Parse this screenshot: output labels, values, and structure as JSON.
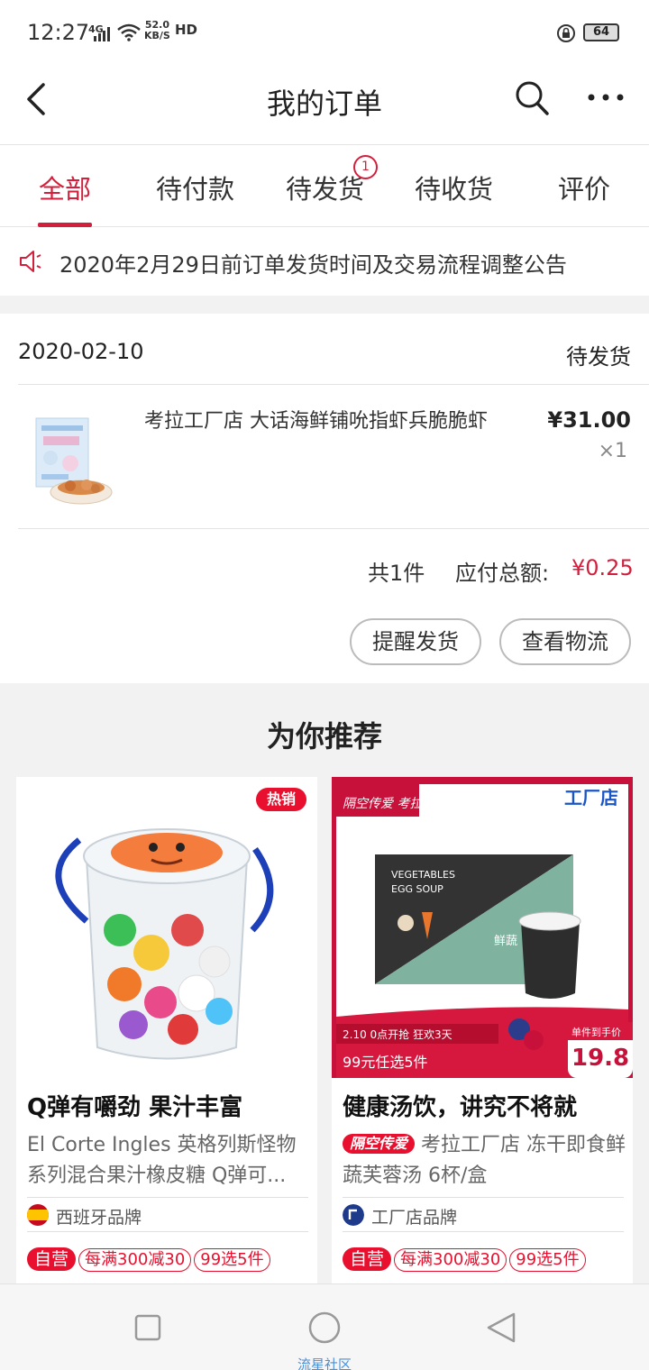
{
  "status_bar": {
    "time": "12:27",
    "network": "4G",
    "speed_value": "52.0",
    "speed_unit": "KB/S",
    "hd": "HD",
    "battery": "64"
  },
  "nav": {
    "title": "我的订单"
  },
  "tabs": [
    {
      "label": "全部",
      "active": true
    },
    {
      "label": "待付款",
      "active": false
    },
    {
      "label": "待发货",
      "active": false,
      "badge": "1"
    },
    {
      "label": "待收货",
      "active": false
    },
    {
      "label": "评价",
      "active": false
    }
  ],
  "notice": {
    "text": "2020年2月29日前订单发货时间及交易流程调整公告"
  },
  "order": {
    "date": "2020-02-10",
    "status": "待发货",
    "product_name": "考拉工厂店 大话海鲜铺吮指虾兵脆脆虾",
    "price": "¥31.00",
    "quantity": "×1",
    "count_text": "共1件",
    "total_label": "应付总额:",
    "total_value": "¥0.25",
    "buttons": {
      "remind": "提醒发货",
      "logistics": "查看物流"
    }
  },
  "recommend": {
    "title": "为你推荐",
    "items": [
      {
        "hot_tag": "热销",
        "headline": "Q弹有嚼劲 果汁丰富",
        "desc": "El Corte Ingles 英格列斯怪物系列混合果汁橡皮糖 Q弹可...",
        "brand": "西班牙品牌",
        "self_tag": "自营",
        "promo1": "每满300减30",
        "promo2": "99选5件"
      },
      {
        "banner_left": "隔空传爱 考拉免息",
        "banner_right": "工厂店",
        "box_text_1": "VEGETABLES",
        "box_text_2": "EGG SOUP",
        "cup_text": "鲜蔬",
        "promo_date": "2.10 0点开抢 狂欢3天",
        "promo_offer": "99元任选5件",
        "price_label": "单件到手价",
        "price_value": "19.8",
        "headline": "健康汤饮，讲究不将就",
        "inline_tag": "隔空传爱",
        "desc": "考拉工厂店 冻干即食鲜蔬芙蓉汤 6杯/盒",
        "brand": "工厂店品牌",
        "self_tag": "自营",
        "promo1": "每满300减30",
        "promo2": "99选5件"
      }
    ]
  },
  "bottom": {
    "watermark": "流星社区"
  },
  "colors": {
    "accent": "#d21f3c",
    "tag_red": "#e8102e"
  }
}
